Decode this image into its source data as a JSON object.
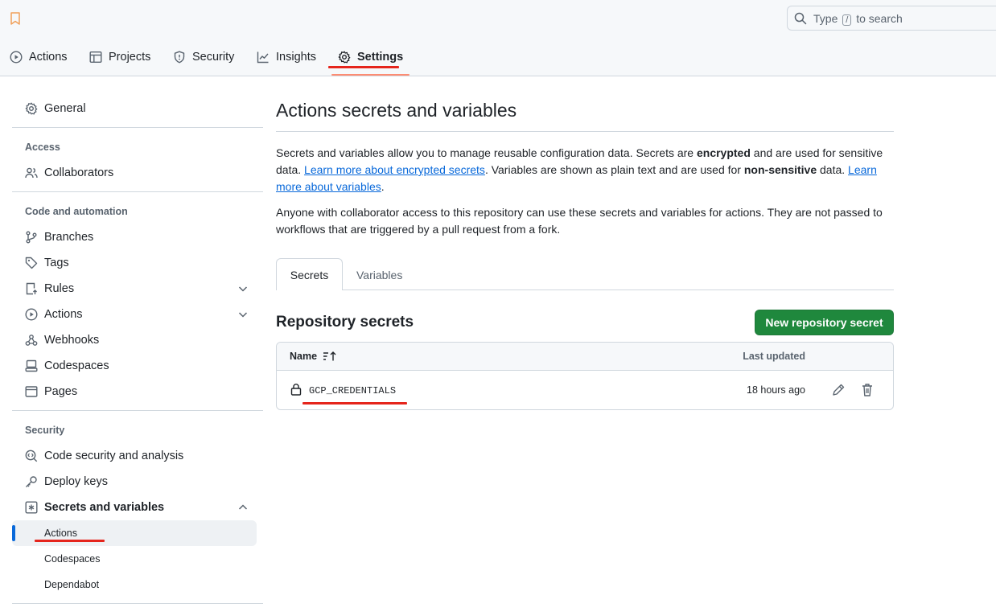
{
  "search": {
    "prefix": "Type",
    "key": "/",
    "suffix": "to search"
  },
  "repo_tabs": [
    {
      "label": "Actions",
      "icon": "play-icon"
    },
    {
      "label": "Projects",
      "icon": "table-icon"
    },
    {
      "label": "Security",
      "icon": "shield-icon"
    },
    {
      "label": "Insights",
      "icon": "graph-icon"
    },
    {
      "label": "Settings",
      "icon": "gear-icon",
      "active": true
    }
  ],
  "sidebar": {
    "general": "General",
    "access_heading": "Access",
    "collaborators": "Collaborators",
    "code_heading": "Code and automation",
    "code_items": [
      "Branches",
      "Tags",
      "Rules",
      "Actions",
      "Webhooks",
      "Codespaces",
      "Pages"
    ],
    "security_heading": "Security",
    "security_items": [
      "Code security and analysis",
      "Deploy keys",
      "Secrets and variables"
    ],
    "secrets_sub": [
      "Actions",
      "Codespaces",
      "Dependabot"
    ],
    "active_sub": "Actions"
  },
  "main": {
    "title": "Actions secrets and variables",
    "p1": {
      "t1": "Secrets and variables allow you to manage reusable configuration data. Secrets are ",
      "b1": "encrypted",
      "t2": " and are used for sensitive data. ",
      "link1": "Learn more about encrypted secrets",
      "t3": ". Variables are shown as plain text and are used for ",
      "b2": "non-sensitive",
      "t4": " data. ",
      "link2": "Learn more about variables",
      "t5": "."
    },
    "p2": "Anyone with collaborator access to this repository can use these secrets and variables for actions. They are not passed to workflows that are triggered by a pull request from a fork.",
    "tabs": {
      "secrets": "Secrets",
      "variables": "Variables"
    },
    "section_title": "Repository secrets",
    "new_button": "New repository secret",
    "table": {
      "col_name": "Name",
      "col_updated": "Last updated",
      "rows": [
        {
          "name": "GCP_CREDENTIALS",
          "updated": "18 hours ago"
        }
      ]
    }
  },
  "colors": {
    "accent": "#0969da",
    "primary_button": "#1f883d",
    "annotation": "#e5251c"
  }
}
